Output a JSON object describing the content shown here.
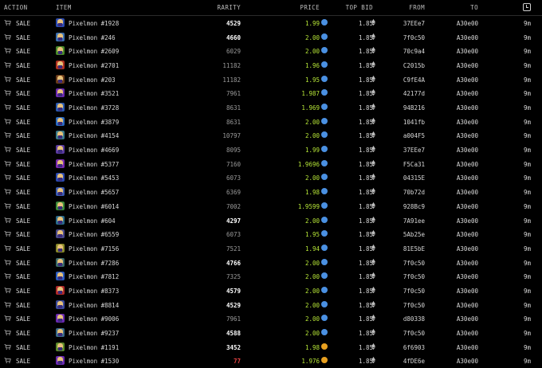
{
  "columns": {
    "action": "ACTION",
    "item": "ITEM",
    "rarity": "RARITY",
    "price": "PRICE",
    "top_bid": "TOP BID",
    "from": "FROM",
    "to": "TO"
  },
  "colors": {
    "green": "#b8e838",
    "blue_coin": "#4a90e2",
    "orange_coin": "#e8a020",
    "rare": "#e04040"
  },
  "rows": [
    {
      "action": "SALE",
      "item": "Pixelmon #1928",
      "rarity": "4529",
      "rarity_style": "bold",
      "price": "1.99",
      "price_style": "green",
      "coin": "blue",
      "top_bid": "1.85",
      "from": "37EEe7",
      "to": "A30e00",
      "time": "9m",
      "thumb": "#2b4bb0"
    },
    {
      "action": "SALE",
      "item": "Pixelmon #246",
      "rarity": "4660",
      "rarity_style": "bold",
      "price": "2.00",
      "price_style": "green",
      "coin": "blue",
      "top_bid": "1.85",
      "from": "7f0c50",
      "to": "A30e00",
      "time": "9m",
      "thumb": "#3a6fb0"
    },
    {
      "action": "SALE",
      "item": "Pixelmon #2609",
      "rarity": "6029",
      "rarity_style": "dim",
      "price": "2.00",
      "price_style": "green",
      "coin": "blue",
      "top_bid": "1.85",
      "from": "70c9a4",
      "to": "A30e00",
      "time": "9m",
      "thumb": "#4a8a2a"
    },
    {
      "action": "SALE",
      "item": "Pixelmon #2701",
      "rarity": "11182",
      "rarity_style": "dim",
      "price": "1.96",
      "price_style": "green",
      "coin": "blue",
      "top_bid": "1.85",
      "from": "C2015b",
      "to": "A30e00",
      "time": "9m",
      "thumb": "#b03020"
    },
    {
      "action": "SALE",
      "item": "Pixelmon #203",
      "rarity": "11182",
      "rarity_style": "dim",
      "price": "1.95",
      "price_style": "green",
      "coin": "blue",
      "top_bid": "1.85",
      "from": "C9fE4A",
      "to": "A30e00",
      "time": "9m",
      "thumb": "#6a3a1a"
    },
    {
      "action": "SALE",
      "item": "Pixelmon #3521",
      "rarity": "7961",
      "rarity_style": "dim",
      "price": "1.987",
      "price_style": "green",
      "coin": "blue",
      "top_bid": "1.85",
      "from": "42177d",
      "to": "A30e00",
      "time": "9m",
      "thumb": "#6a2ab0"
    },
    {
      "action": "SALE",
      "item": "Pixelmon #3728",
      "rarity": "8631",
      "rarity_style": "dim",
      "price": "1.969",
      "price_style": "green",
      "coin": "blue",
      "top_bid": "1.85",
      "from": "94B216",
      "to": "A30e00",
      "time": "9m",
      "thumb": "#2a5ab0"
    },
    {
      "action": "SALE",
      "item": "Pixelmon #3879",
      "rarity": "8631",
      "rarity_style": "dim",
      "price": "2.00",
      "price_style": "green",
      "coin": "blue",
      "top_bid": "1.85",
      "from": "1041fb",
      "to": "A30e00",
      "time": "9m",
      "thumb": "#2a6ac0"
    },
    {
      "action": "SALE",
      "item": "Pixelmon #4154",
      "rarity": "10797",
      "rarity_style": "dim",
      "price": "2.00",
      "price_style": "green",
      "coin": "blue",
      "top_bid": "1.85",
      "from": "a004F5",
      "to": "A30e00",
      "time": "9m",
      "thumb": "#3a7a8a"
    },
    {
      "action": "SALE",
      "item": "Pixelmon #4669",
      "rarity": "8095",
      "rarity_style": "dim",
      "price": "1.99",
      "price_style": "green",
      "coin": "blue",
      "top_bid": "1.85",
      "from": "37EEe7",
      "to": "A30e00",
      "time": "9m",
      "thumb": "#5a3aa0"
    },
    {
      "action": "SALE",
      "item": "Pixelmon #5377",
      "rarity": "7160",
      "rarity_style": "dim",
      "price": "1.9696",
      "price_style": "green",
      "coin": "blue",
      "top_bid": "1.85",
      "from": "F5Ca31",
      "to": "A30e00",
      "time": "9m",
      "thumb": "#7a2ab0"
    },
    {
      "action": "SALE",
      "item": "Pixelmon #5453",
      "rarity": "6073",
      "rarity_style": "dim",
      "price": "2.00",
      "price_style": "green",
      "coin": "blue",
      "top_bid": "1.85",
      "from": "04315E",
      "to": "A30e00",
      "time": "9m",
      "thumb": "#2a4ab0"
    },
    {
      "action": "SALE",
      "item": "Pixelmon #5657",
      "rarity": "6369",
      "rarity_style": "dim",
      "price": "1.98",
      "price_style": "green",
      "coin": "blue",
      "top_bid": "1.85",
      "from": "70b72d",
      "to": "A30e00",
      "time": "9m",
      "thumb": "#3a5ab0"
    },
    {
      "action": "SALE",
      "item": "Pixelmon #6014",
      "rarity": "7002",
      "rarity_style": "dim",
      "price": "1.9599",
      "price_style": "green",
      "coin": "blue",
      "top_bid": "1.85",
      "from": "928Bc9",
      "to": "A30e00",
      "time": "9m",
      "thumb": "#3a8a3a"
    },
    {
      "action": "SALE",
      "item": "Pixelmon #604",
      "rarity": "4297",
      "rarity_style": "bold",
      "price": "2.00",
      "price_style": "green",
      "coin": "blue",
      "top_bid": "1.85",
      "from": "7A91ee",
      "to": "A30e00",
      "time": "9m",
      "thumb": "#2a6a8a"
    },
    {
      "action": "SALE",
      "item": "Pixelmon #6559",
      "rarity": "6073",
      "rarity_style": "dim",
      "price": "1.95",
      "price_style": "green",
      "coin": "blue",
      "top_bid": "1.85",
      "from": "5Ab25e",
      "to": "A30e00",
      "time": "9m",
      "thumb": "#4a4a8a"
    },
    {
      "action": "SALE",
      "item": "Pixelmon #7156",
      "rarity": "7521",
      "rarity_style": "dim",
      "price": "1.94",
      "price_style": "green",
      "coin": "blue",
      "top_bid": "1.85",
      "from": "81E5bE",
      "to": "A30e00",
      "time": "9m",
      "thumb": "#8a8a2a"
    },
    {
      "action": "SALE",
      "item": "Pixelmon #7286",
      "rarity": "4766",
      "rarity_style": "bold",
      "price": "2.00",
      "price_style": "green",
      "coin": "blue",
      "top_bid": "1.85",
      "from": "7f0c50",
      "to": "A30e00",
      "time": "9m",
      "thumb": "#3a6a6a"
    },
    {
      "action": "SALE",
      "item": "Pixelmon #7812",
      "rarity": "7325",
      "rarity_style": "dim",
      "price": "2.00",
      "price_style": "green",
      "coin": "blue",
      "top_bid": "1.85",
      "from": "7f0c50",
      "to": "A30e00",
      "time": "9m",
      "thumb": "#2a5ac0"
    },
    {
      "action": "SALE",
      "item": "Pixelmon #8373",
      "rarity": "4579",
      "rarity_style": "bold",
      "price": "2.00",
      "price_style": "green",
      "coin": "blue",
      "top_bid": "1.85",
      "from": "7f0c50",
      "to": "A30e00",
      "time": "9m",
      "thumb": "#b02a2a"
    },
    {
      "action": "SALE",
      "item": "Pixelmon #8814",
      "rarity": "4529",
      "rarity_style": "bold",
      "price": "2.00",
      "price_style": "green",
      "coin": "blue",
      "top_bid": "1.85",
      "from": "7f0c50",
      "to": "A30e00",
      "time": "9m",
      "thumb": "#3a4a9a"
    },
    {
      "action": "SALE",
      "item": "Pixelmon #9006",
      "rarity": "7961",
      "rarity_style": "dim",
      "price": "2.00",
      "price_style": "green",
      "coin": "blue",
      "top_bid": "1.85",
      "from": "d80338",
      "to": "A30e00",
      "time": "9m",
      "thumb": "#6a2ab0"
    },
    {
      "action": "SALE",
      "item": "Pixelmon #9237",
      "rarity": "4588",
      "rarity_style": "bold",
      "price": "2.00",
      "price_style": "green",
      "coin": "blue",
      "top_bid": "1.85",
      "from": "7f0c50",
      "to": "A30e00",
      "time": "9m",
      "thumb": "#3a6a8a"
    },
    {
      "action": "SALE",
      "item": "Pixelmon #1191",
      "rarity": "3452",
      "rarity_style": "bold",
      "price": "1.98",
      "price_style": "green",
      "coin": "orange",
      "top_bid": "1.85",
      "from": "6f6903",
      "to": "A30e00",
      "time": "9m",
      "thumb": "#5a8a2a"
    },
    {
      "action": "SALE",
      "item": "Pixelmon #1530",
      "rarity": "77",
      "rarity_style": "red",
      "price": "1.976",
      "price_style": "green",
      "coin": "orange",
      "top_bid": "1.85",
      "from": "4fDE6e",
      "to": "A30e00",
      "time": "9m",
      "thumb": "#6a2ab0"
    }
  ]
}
